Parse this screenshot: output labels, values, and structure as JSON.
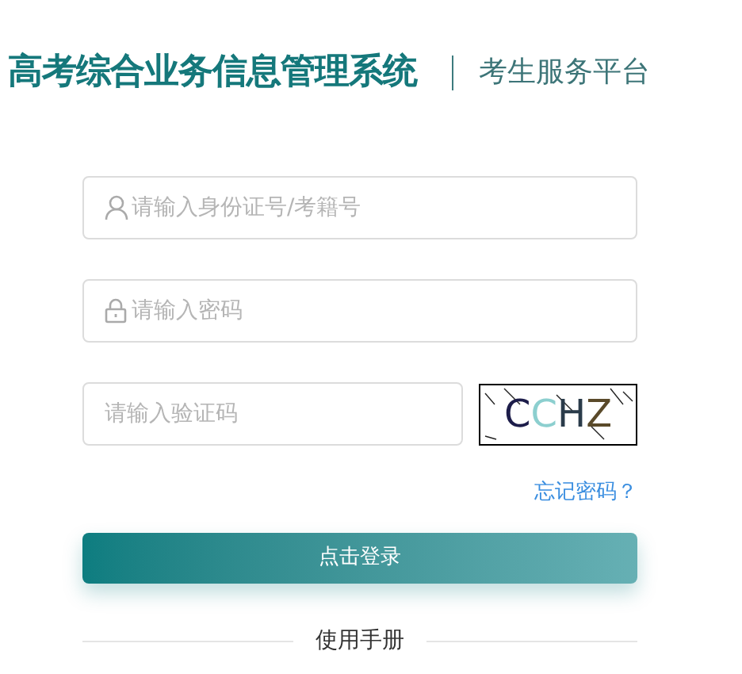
{
  "header": {
    "title": "高考综合业务信息管理系统",
    "subtitle": "考生服务平台"
  },
  "fields": [
    {
      "kind": "user",
      "placeholder": "请输入身份证号/考籍号"
    },
    {
      "kind": "lock",
      "placeholder": "请输入密码"
    },
    {
      "kind": "captcha",
      "placeholder": "请输入验证码",
      "captcha": "CCHZ"
    }
  ],
  "forgot_link": "忘记密码？",
  "login_button": "点击登录",
  "manual_link": "使用手册"
}
